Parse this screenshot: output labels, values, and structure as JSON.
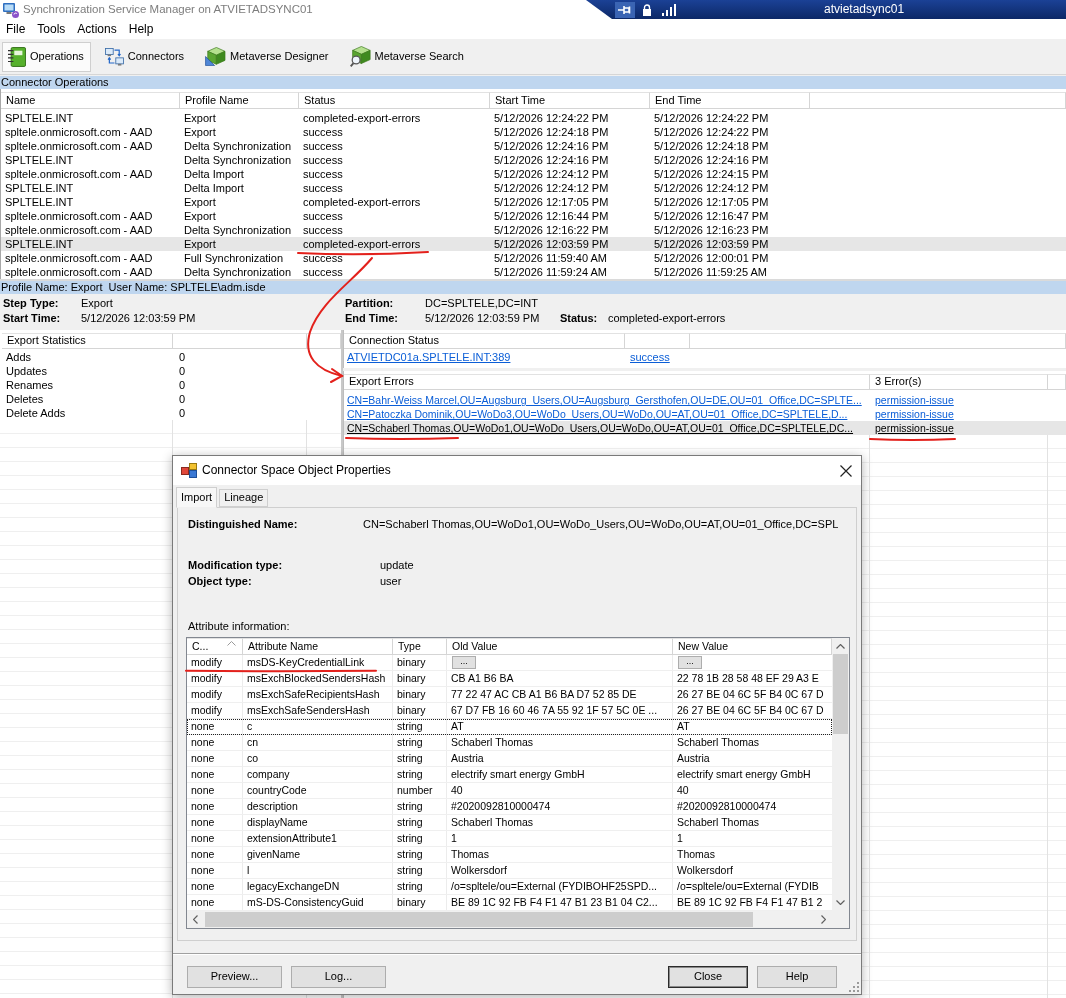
{
  "window": {
    "title": "Synchronization Service Manager on ATVIETADSYNC01"
  },
  "connection_bar": {
    "host": "atvietadsync01"
  },
  "menu": [
    "File",
    "Tools",
    "Actions",
    "Help"
  ],
  "toolbar": [
    {
      "label": "Operations",
      "kind": "operations",
      "selected": true
    },
    {
      "label": "Connectors",
      "kind": "connectors",
      "selected": false
    },
    {
      "label": "Metaverse Designer",
      "kind": "designer",
      "selected": false
    },
    {
      "label": "Metaverse Search",
      "kind": "search",
      "selected": false
    }
  ],
  "operations": {
    "title": "Connector Operations",
    "columns": [
      "Name",
      "Profile Name",
      "Status",
      "Start Time",
      "End Time"
    ],
    "rows": [
      {
        "name": "SPLTELE.INT",
        "profile": "Export",
        "status": "completed-export-errors",
        "start": "5/12/2026 12:24:22 PM",
        "end": "5/12/2026 12:24:22 PM",
        "selected": false
      },
      {
        "name": "spltele.onmicrosoft.com - AAD",
        "profile": "Export",
        "status": "success",
        "start": "5/12/2026 12:24:18 PM",
        "end": "5/12/2026 12:24:22 PM",
        "selected": false
      },
      {
        "name": "spltele.onmicrosoft.com - AAD",
        "profile": "Delta Synchronization",
        "status": "success",
        "start": "5/12/2026 12:24:16 PM",
        "end": "5/12/2026 12:24:18 PM",
        "selected": false
      },
      {
        "name": "SPLTELE.INT",
        "profile": "Delta Synchronization",
        "status": "success",
        "start": "5/12/2026 12:24:16 PM",
        "end": "5/12/2026 12:24:16 PM",
        "selected": false
      },
      {
        "name": "spltele.onmicrosoft.com - AAD",
        "profile": "Delta Import",
        "status": "success",
        "start": "5/12/2026 12:24:12 PM",
        "end": "5/12/2026 12:24:15 PM",
        "selected": false
      },
      {
        "name": "SPLTELE.INT",
        "profile": "Delta Import",
        "status": "success",
        "start": "5/12/2026 12:24:12 PM",
        "end": "5/12/2026 12:24:12 PM",
        "selected": false
      },
      {
        "name": "SPLTELE.INT",
        "profile": "Export",
        "status": "completed-export-errors",
        "start": "5/12/2026 12:17:05 PM",
        "end": "5/12/2026 12:17:05 PM",
        "selected": false
      },
      {
        "name": "spltele.onmicrosoft.com - AAD",
        "profile": "Export",
        "status": "success",
        "start": "5/12/2026 12:16:44 PM",
        "end": "5/12/2026 12:16:47 PM",
        "selected": false
      },
      {
        "name": "spltele.onmicrosoft.com - AAD",
        "profile": "Delta Synchronization",
        "status": "success",
        "start": "5/12/2026 12:16:22 PM",
        "end": "5/12/2026 12:16:23 PM",
        "selected": false
      },
      {
        "name": "SPLTELE.INT",
        "profile": "Export",
        "status": "completed-export-errors",
        "start": "5/12/2026 12:03:59 PM",
        "end": "5/12/2026 12:03:59 PM",
        "selected": true
      },
      {
        "name": "spltele.onmicrosoft.com - AAD",
        "profile": "Full Synchronization",
        "status": "success",
        "start": "5/12/2026 11:59:40 AM",
        "end": "5/12/2026 12:00:01 PM",
        "selected": false
      },
      {
        "name": "spltele.onmicrosoft.com - AAD",
        "profile": "Delta Synchronization",
        "status": "success",
        "start": "5/12/2026 11:59:24 AM",
        "end": "5/12/2026 11:59:25 AM",
        "selected": false
      }
    ]
  },
  "run_details": {
    "header": "Profile Name: Export  User Name: SPLTELE\\adm.isde",
    "step_type": {
      "label": "Step Type:",
      "value": "Export"
    },
    "start_time": {
      "label": "Start Time:",
      "value": "5/12/2026 12:03:59 PM"
    },
    "partition": {
      "label": "Partition:",
      "value": "DC=SPLTELE,DC=INT"
    },
    "end_time": {
      "label": "End Time:",
      "value": "5/12/2026 12:03:59 PM"
    },
    "status": {
      "label": "Status:",
      "value": "completed-export-errors"
    }
  },
  "export_statistics": {
    "columns": [
      "Export Statistics"
    ],
    "rows": [
      {
        "label": "Adds",
        "value": "0"
      },
      {
        "label": "Updates",
        "value": "0"
      },
      {
        "label": "Renames",
        "value": "0"
      },
      {
        "label": "Deletes",
        "value": "0"
      },
      {
        "label": "Delete Adds",
        "value": "0"
      }
    ]
  },
  "connection_status": {
    "columns": [
      "Connection Status"
    ],
    "rows": [
      {
        "server": "ATVIETDC01a.SPLTELE.INT:389",
        "result": "success"
      }
    ]
  },
  "export_errors": {
    "columns": [
      "Export Errors",
      "3 Error(s)"
    ],
    "rows": [
      {
        "dn": "CN=Bahr-Weiss Marcel,OU=Augsburg_Users,OU=Augsburg_Gersthofen,OU=DE,OU=01_Office,DC=SPLTE...",
        "error": "permission-issue",
        "selected": false
      },
      {
        "dn": "CN=Patoczka Dominik,OU=WoDo3,OU=WoDo_Users,OU=WoDo,OU=AT,OU=01_Office,DC=SPLTELE,D...",
        "error": "permission-issue",
        "selected": false
      },
      {
        "dn": "CN=Schaberl Thomas,OU=WoDo1,OU=WoDo_Users,OU=WoDo,OU=AT,OU=01_Office,DC=SPLTELE,DC...",
        "error": "permission-issue",
        "selected": true
      }
    ]
  },
  "dialog": {
    "title": "Connector Space Object Properties",
    "tabs": [
      {
        "label": "Import",
        "selected": true
      },
      {
        "label": "Lineage",
        "selected": false
      }
    ],
    "distinguished_name": {
      "label": "Distinguished Name:",
      "value": "CN=Schaberl Thomas,OU=WoDo1,OU=WoDo_Users,OU=WoDo,OU=AT,OU=01_Office,DC=SPL"
    },
    "fields": [
      {
        "label": "Modification type:",
        "value": "update"
      },
      {
        "label": "Object type:",
        "value": "user"
      }
    ],
    "attributes": {
      "title": "Attribute information:",
      "columns": [
        {
          "label": "C...",
          "sorted": true
        },
        {
          "label": "Attribute Name",
          "sorted": false
        },
        {
          "label": "Type",
          "sorted": false
        },
        {
          "label": "Old Value",
          "sorted": false
        },
        {
          "label": "New Value",
          "sorted": false
        }
      ],
      "rows": [
        {
          "change": "modify",
          "name": "msDS-KeyCredentialLink",
          "type": "binary",
          "kind": "button",
          "old_value": "...",
          "new_value": "...",
          "focused": false
        },
        {
          "change": "modify",
          "name": "msExchBlockedSendersHash",
          "type": "binary",
          "kind": "text",
          "old_value": "CB A1 B6 BA",
          "new_value": "22 78 1B 28 58 48 EF 29 A3 E",
          "focused": false
        },
        {
          "change": "modify",
          "name": "msExchSafeRecipientsHash",
          "type": "binary",
          "kind": "text",
          "old_value": "77 22 47 AC CB A1 B6 BA D7 52 85 DE",
          "new_value": "26 27 BE 04 6C 5F B4 0C 67 D",
          "focused": false
        },
        {
          "change": "modify",
          "name": "msExchSafeSendersHash",
          "type": "binary",
          "kind": "text",
          "old_value": "67 D7 FB 16 60 46 7A 55 92 1F 57 5C 0E ...",
          "new_value": "26 27 BE 04 6C 5F B4 0C 67 D",
          "focused": false
        },
        {
          "change": "none",
          "name": "c",
          "type": "string",
          "kind": "text",
          "old_value": "AT",
          "new_value": "AT",
          "focused": true
        },
        {
          "change": "none",
          "name": "cn",
          "type": "string",
          "kind": "text",
          "old_value": "Schaberl Thomas",
          "new_value": "Schaberl Thomas",
          "focused": false
        },
        {
          "change": "none",
          "name": "co",
          "type": "string",
          "kind": "text",
          "old_value": "Austria",
          "new_value": "Austria",
          "focused": false
        },
        {
          "change": "none",
          "name": "company",
          "type": "string",
          "kind": "text",
          "old_value": "electrify smart energy GmbH",
          "new_value": "electrify smart energy GmbH",
          "focused": false
        },
        {
          "change": "none",
          "name": "countryCode",
          "type": "number",
          "kind": "text",
          "old_value": "40",
          "new_value": "40",
          "focused": false
        },
        {
          "change": "none",
          "name": "description",
          "type": "string",
          "kind": "text",
          "old_value": "#2020092810000474",
          "new_value": "#2020092810000474",
          "focused": false
        },
        {
          "change": "none",
          "name": "displayName",
          "type": "string",
          "kind": "text",
          "old_value": "Schaberl Thomas",
          "new_value": "Schaberl Thomas",
          "focused": false
        },
        {
          "change": "none",
          "name": "extensionAttribute1",
          "type": "string",
          "kind": "text",
          "old_value": "1",
          "new_value": "1",
          "focused": false
        },
        {
          "change": "none",
          "name": "givenName",
          "type": "string",
          "kind": "text",
          "old_value": "Thomas",
          "new_value": "Thomas",
          "focused": false
        },
        {
          "change": "none",
          "name": "l",
          "type": "string",
          "kind": "text",
          "old_value": "Wolkersdorf",
          "new_value": "Wolkersdorf",
          "focused": false
        },
        {
          "change": "none",
          "name": "legacyExchangeDN",
          "type": "string",
          "kind": "text",
          "old_value": "/o=spltele/ou=External (FYDIBOHF25SPD...",
          "new_value": "/o=spltele/ou=External (FYDIB",
          "focused": false
        },
        {
          "change": "none",
          "name": "mS-DS-ConsistencyGuid",
          "type": "binary",
          "kind": "text",
          "old_value": "BE 89 1C 92 FB F4 F1 47 B1 23 B1 04 C2...",
          "new_value": "BE 89 1C 92 FB F4 F1 47 B1 2",
          "focused": false
        }
      ]
    },
    "footer": {
      "left": [
        {
          "label": "Preview...",
          "default": false
        },
        {
          "label": "Log...",
          "default": false
        }
      ],
      "right": [
        {
          "label": "Close",
          "default": true
        },
        {
          "label": "Help",
          "default": false
        }
      ]
    }
  }
}
